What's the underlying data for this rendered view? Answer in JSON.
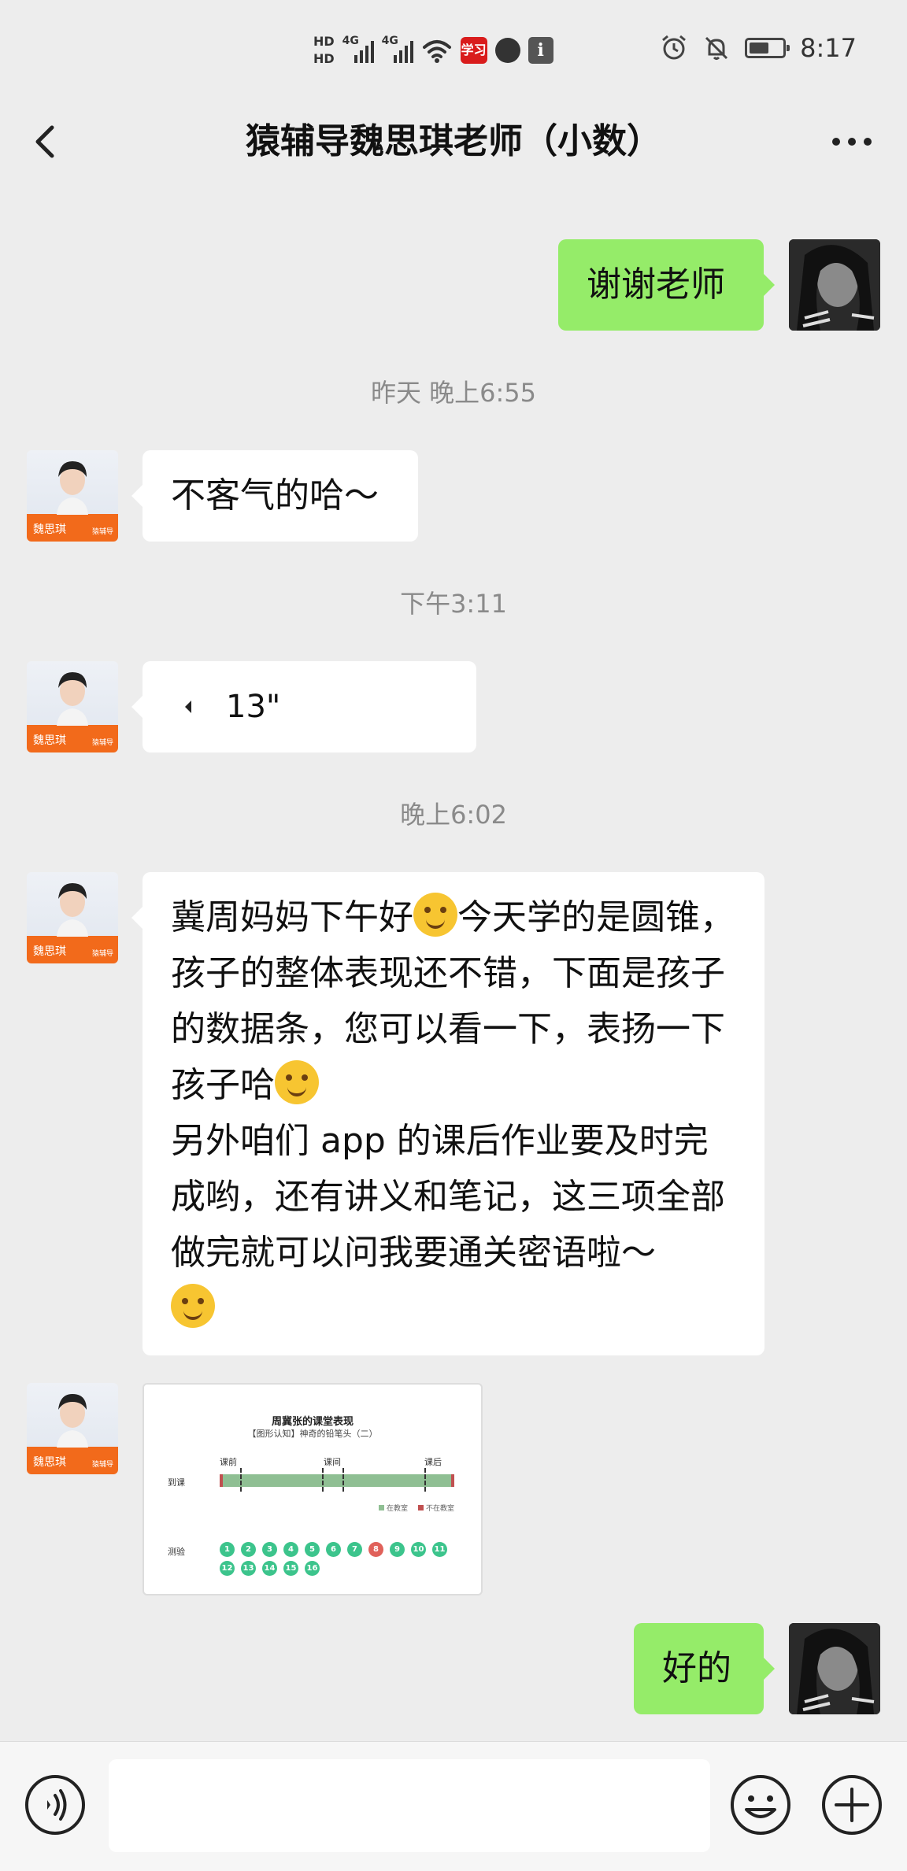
{
  "status_bar": {
    "hd1": "HD",
    "hd2": "HD",
    "net1": "4G",
    "net2": "4G",
    "app_red_label": "学习",
    "app_i_label": "i",
    "time": "8:17",
    "battery_level": 0.6
  },
  "nav": {
    "title": "猿辅导魏思琪老师（小数）",
    "back_icon": "chevron-left-icon",
    "more_icon": "more-dots-icon"
  },
  "teacher_avatar": {
    "name": "魏思琪",
    "badge": "猿辅导"
  },
  "messages": {
    "m1": "谢谢老师",
    "t1": "昨天 晚上6:55",
    "m2": "不客气的哈～",
    "t2": "下午3:11",
    "voice_duration": "13\"",
    "t3": "晚上6:02",
    "m4_part1": "冀周妈妈下午好",
    "m4_part2": "今天学的是圆锥，孩子的整体表现还不错，下面是孩子的数据条，您可以看一下，表扬一下孩子哈",
    "m4_part3": "另外咱们 app 的课后作业要及时完成哟，还有讲义和笔记，这三项全部做完就可以问我要通关密语啦～",
    "m6": "好的"
  },
  "image_card": {
    "title": "周冀张的课堂表现",
    "subtitle": "【图形认知】神奇的铅笔头（二）",
    "row_attendance": "到课",
    "row_quiz": "测验",
    "phase_before": "课前",
    "phase_during": "课间",
    "phase_after": "课后",
    "legend_in": "在教室",
    "legend_out": "不在教室",
    "quiz_numbers": [
      "1",
      "2",
      "3",
      "4",
      "5",
      "6",
      "7",
      "8",
      "9",
      "10",
      "11",
      "12",
      "13",
      "14",
      "15",
      "16"
    ],
    "quiz_wrong": [
      "8"
    ]
  },
  "colors": {
    "background": "#ededed",
    "bubble_self": "#95ec69",
    "bubble_other": "#ffffff",
    "timestamp_text": "#8a8a8a",
    "teacher_orange": "#f26a1b"
  },
  "input_bar": {
    "voice_icon": "voice-icon",
    "emoji_icon": "emoji-icon",
    "plus_icon": "plus-icon",
    "input_value": ""
  }
}
